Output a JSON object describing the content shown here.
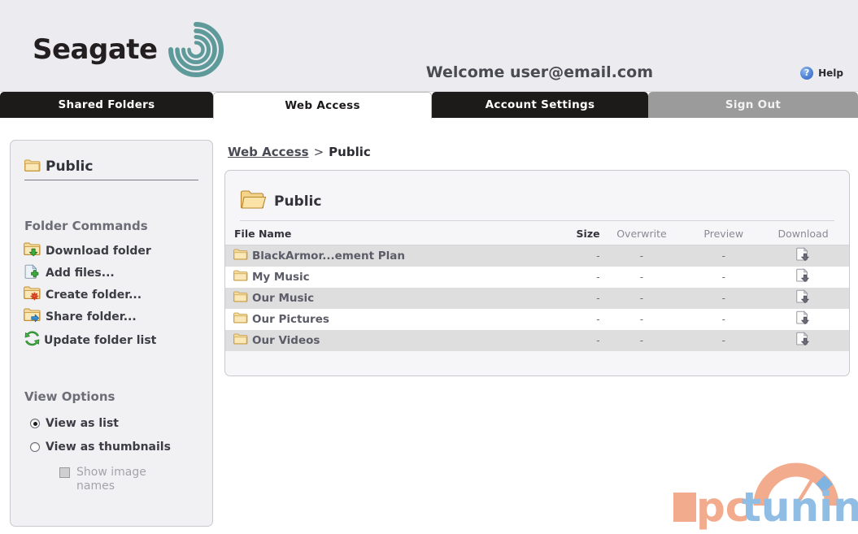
{
  "header": {
    "brand": "Seagate",
    "brand_logo_icon": "seagate-spiral-logo",
    "brand_color": "#5f9a9b",
    "welcome": "Welcome user@email.com",
    "help_label": "Help",
    "help_icon": "question-mark-circle-icon",
    "help_icon_color": "#4a7fd4",
    "background": "#ececf0"
  },
  "tabs": [
    {
      "label": "Shared Folders",
      "state": "inactive",
      "style": "dark"
    },
    {
      "label": "Web Access",
      "state": "active",
      "style": "active"
    },
    {
      "label": "Account Settings",
      "state": "inactive",
      "style": "dark"
    },
    {
      "label": "Sign Out",
      "state": "inactive",
      "style": "grey"
    }
  ],
  "sidebar": {
    "current_folder": "Public",
    "current_folder_icon": "folder-icon",
    "folder_commands_heading": "Folder Commands",
    "commands": [
      {
        "label": "Download folder",
        "icon": "folder-download-icon"
      },
      {
        "label": "Add files...",
        "icon": "page-add-icon"
      },
      {
        "label": "Create folder...",
        "icon": "folder-new-icon"
      },
      {
        "label": "Share folder...",
        "icon": "folder-share-icon"
      },
      {
        "label": "Update folder list",
        "icon": "refresh-icon"
      }
    ],
    "view_options_heading": "View Options",
    "view_options": [
      {
        "label": "View as list",
        "selected": true
      },
      {
        "label": "View as thumbnails",
        "selected": false
      }
    ],
    "show_image_names": {
      "label": "Show image names",
      "checked": false,
      "disabled": true
    }
  },
  "breadcrumb": {
    "root": "Web Access",
    "separator": ">",
    "current": "Public"
  },
  "main": {
    "folder_title": "Public",
    "folder_title_icon": "folder-open-icon",
    "columns": [
      {
        "key": "name",
        "label": "File Name"
      },
      {
        "key": "size",
        "label": "Size"
      },
      {
        "key": "overwrite",
        "label": "Overwrite"
      },
      {
        "key": "preview",
        "label": "Preview"
      },
      {
        "key": "download",
        "label": "Download"
      }
    ],
    "rows": [
      {
        "name": "BlackArmor...ement Plan",
        "size": "-",
        "overwrite": "-",
        "preview": "-",
        "download_icon": "download-file-icon"
      },
      {
        "name": "My Music",
        "size": "-",
        "overwrite": "-",
        "preview": "-",
        "download_icon": "download-file-icon"
      },
      {
        "name": "Our Music",
        "size": "-",
        "overwrite": "-",
        "preview": "-",
        "download_icon": "download-file-icon"
      },
      {
        "name": "Our Pictures",
        "size": "-",
        "overwrite": "-",
        "preview": "-",
        "download_icon": "download-file-icon"
      },
      {
        "name": "Our Videos",
        "size": "-",
        "overwrite": "-",
        "preview": "-",
        "download_icon": "download-file-icon"
      }
    ]
  },
  "watermark": {
    "text_primary": "pc",
    "text_secondary": "tuning",
    "color_primary": "#f0a584",
    "color_secondary": "#8fbde4",
    "icon": "pctuning-gauge-logo"
  }
}
